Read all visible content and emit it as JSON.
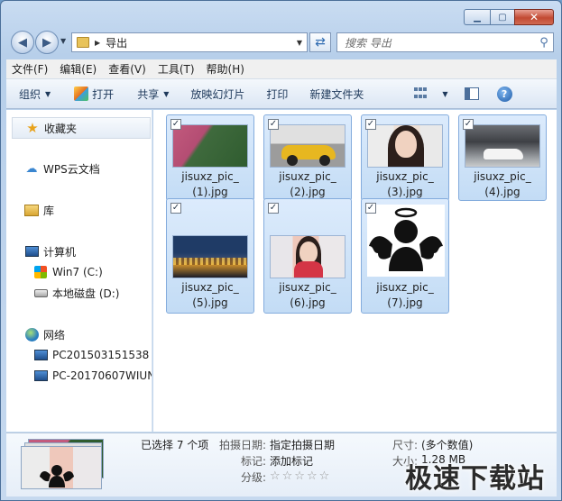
{
  "address": {
    "current_folder": "导出",
    "search_placeholder": "搜索 导出"
  },
  "menu": [
    "文件(F)",
    "编辑(E)",
    "查看(V)",
    "工具(T)",
    "帮助(H)"
  ],
  "toolbar": {
    "organize": "组织",
    "open": "打开",
    "share": "共享",
    "slideshow": "放映幻灯片",
    "print": "打印",
    "new_folder": "新建文件夹"
  },
  "nav": {
    "favorites": "收藏夹",
    "wps_cloud": "WPS云文档",
    "libraries": "库",
    "computer": "计算机",
    "drive_c": "Win7 (C:)",
    "drive_d": "本地磁盘 (D:)",
    "network": "网络",
    "pc1": "PC201503151538",
    "pc2": "PC-20170607WIUN"
  },
  "files": [
    {
      "line1": "jisuxz_pic_",
      "line2": "(1).jpg"
    },
    {
      "line1": "jisuxz_pic_",
      "line2": "(2).jpg"
    },
    {
      "line1": "jisuxz_pic_",
      "line2": "(3).jpg"
    },
    {
      "line1": "jisuxz_pic_",
      "line2": "(4).jpg"
    },
    {
      "line1": "jisuxz_pic_",
      "line2": "(5).jpg"
    },
    {
      "line1": "jisuxz_pic_",
      "line2": "(6).jpg"
    },
    {
      "line1": "jisuxz_pic_",
      "line2": "(7).jpg"
    }
  ],
  "details": {
    "selected": "已选择 7 个项",
    "date_label": "拍摄日期:",
    "date_value": "指定拍摄日期",
    "tags_label": "标记:",
    "tags_value": "添加标记",
    "rating_label": "分级:",
    "size_dim_label": "尺寸:",
    "size_dim_value": "(多个数值)",
    "filesize_label": "大小:",
    "filesize_value": "1.28 MB"
  },
  "watermark": "极速下载站",
  "checkmark": "✓"
}
